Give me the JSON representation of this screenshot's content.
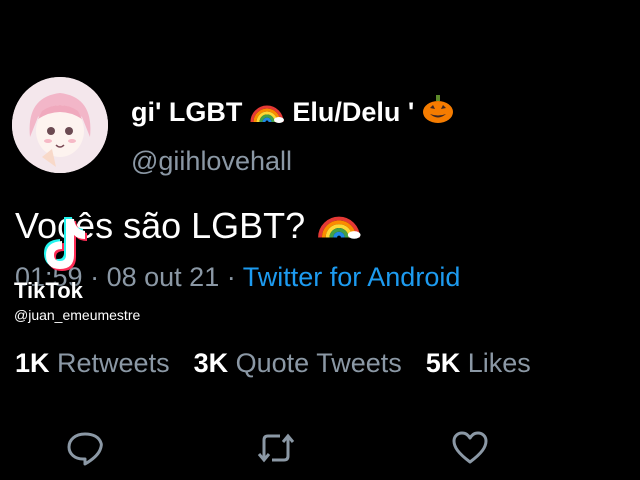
{
  "author": {
    "display_name": "gi' LGBT",
    "pronouns": "Elu/Delu '",
    "handle": "@giihlovehall",
    "avatar_icon": "anime-girl-avatar"
  },
  "tweet": {
    "text": "Vocês são LGBT?",
    "time": "01:59",
    "date": "08 out 21",
    "source": "Twitter for Android",
    "separator": "·"
  },
  "watermark": {
    "brand": "TikTok",
    "user": "@juan_emeumestre"
  },
  "stats": {
    "retweets_count": "1K",
    "retweets_label": "Retweets",
    "quotes_count": "3K",
    "quotes_label": "Quote Tweets",
    "likes_count": "5K",
    "likes_label": "Likes"
  },
  "actions": [
    "reply-icon",
    "retweet-icon",
    "like-icon"
  ],
  "colors": {
    "background": "#000000",
    "link": "#1d9bf0",
    "muted": "#8b98a5"
  }
}
